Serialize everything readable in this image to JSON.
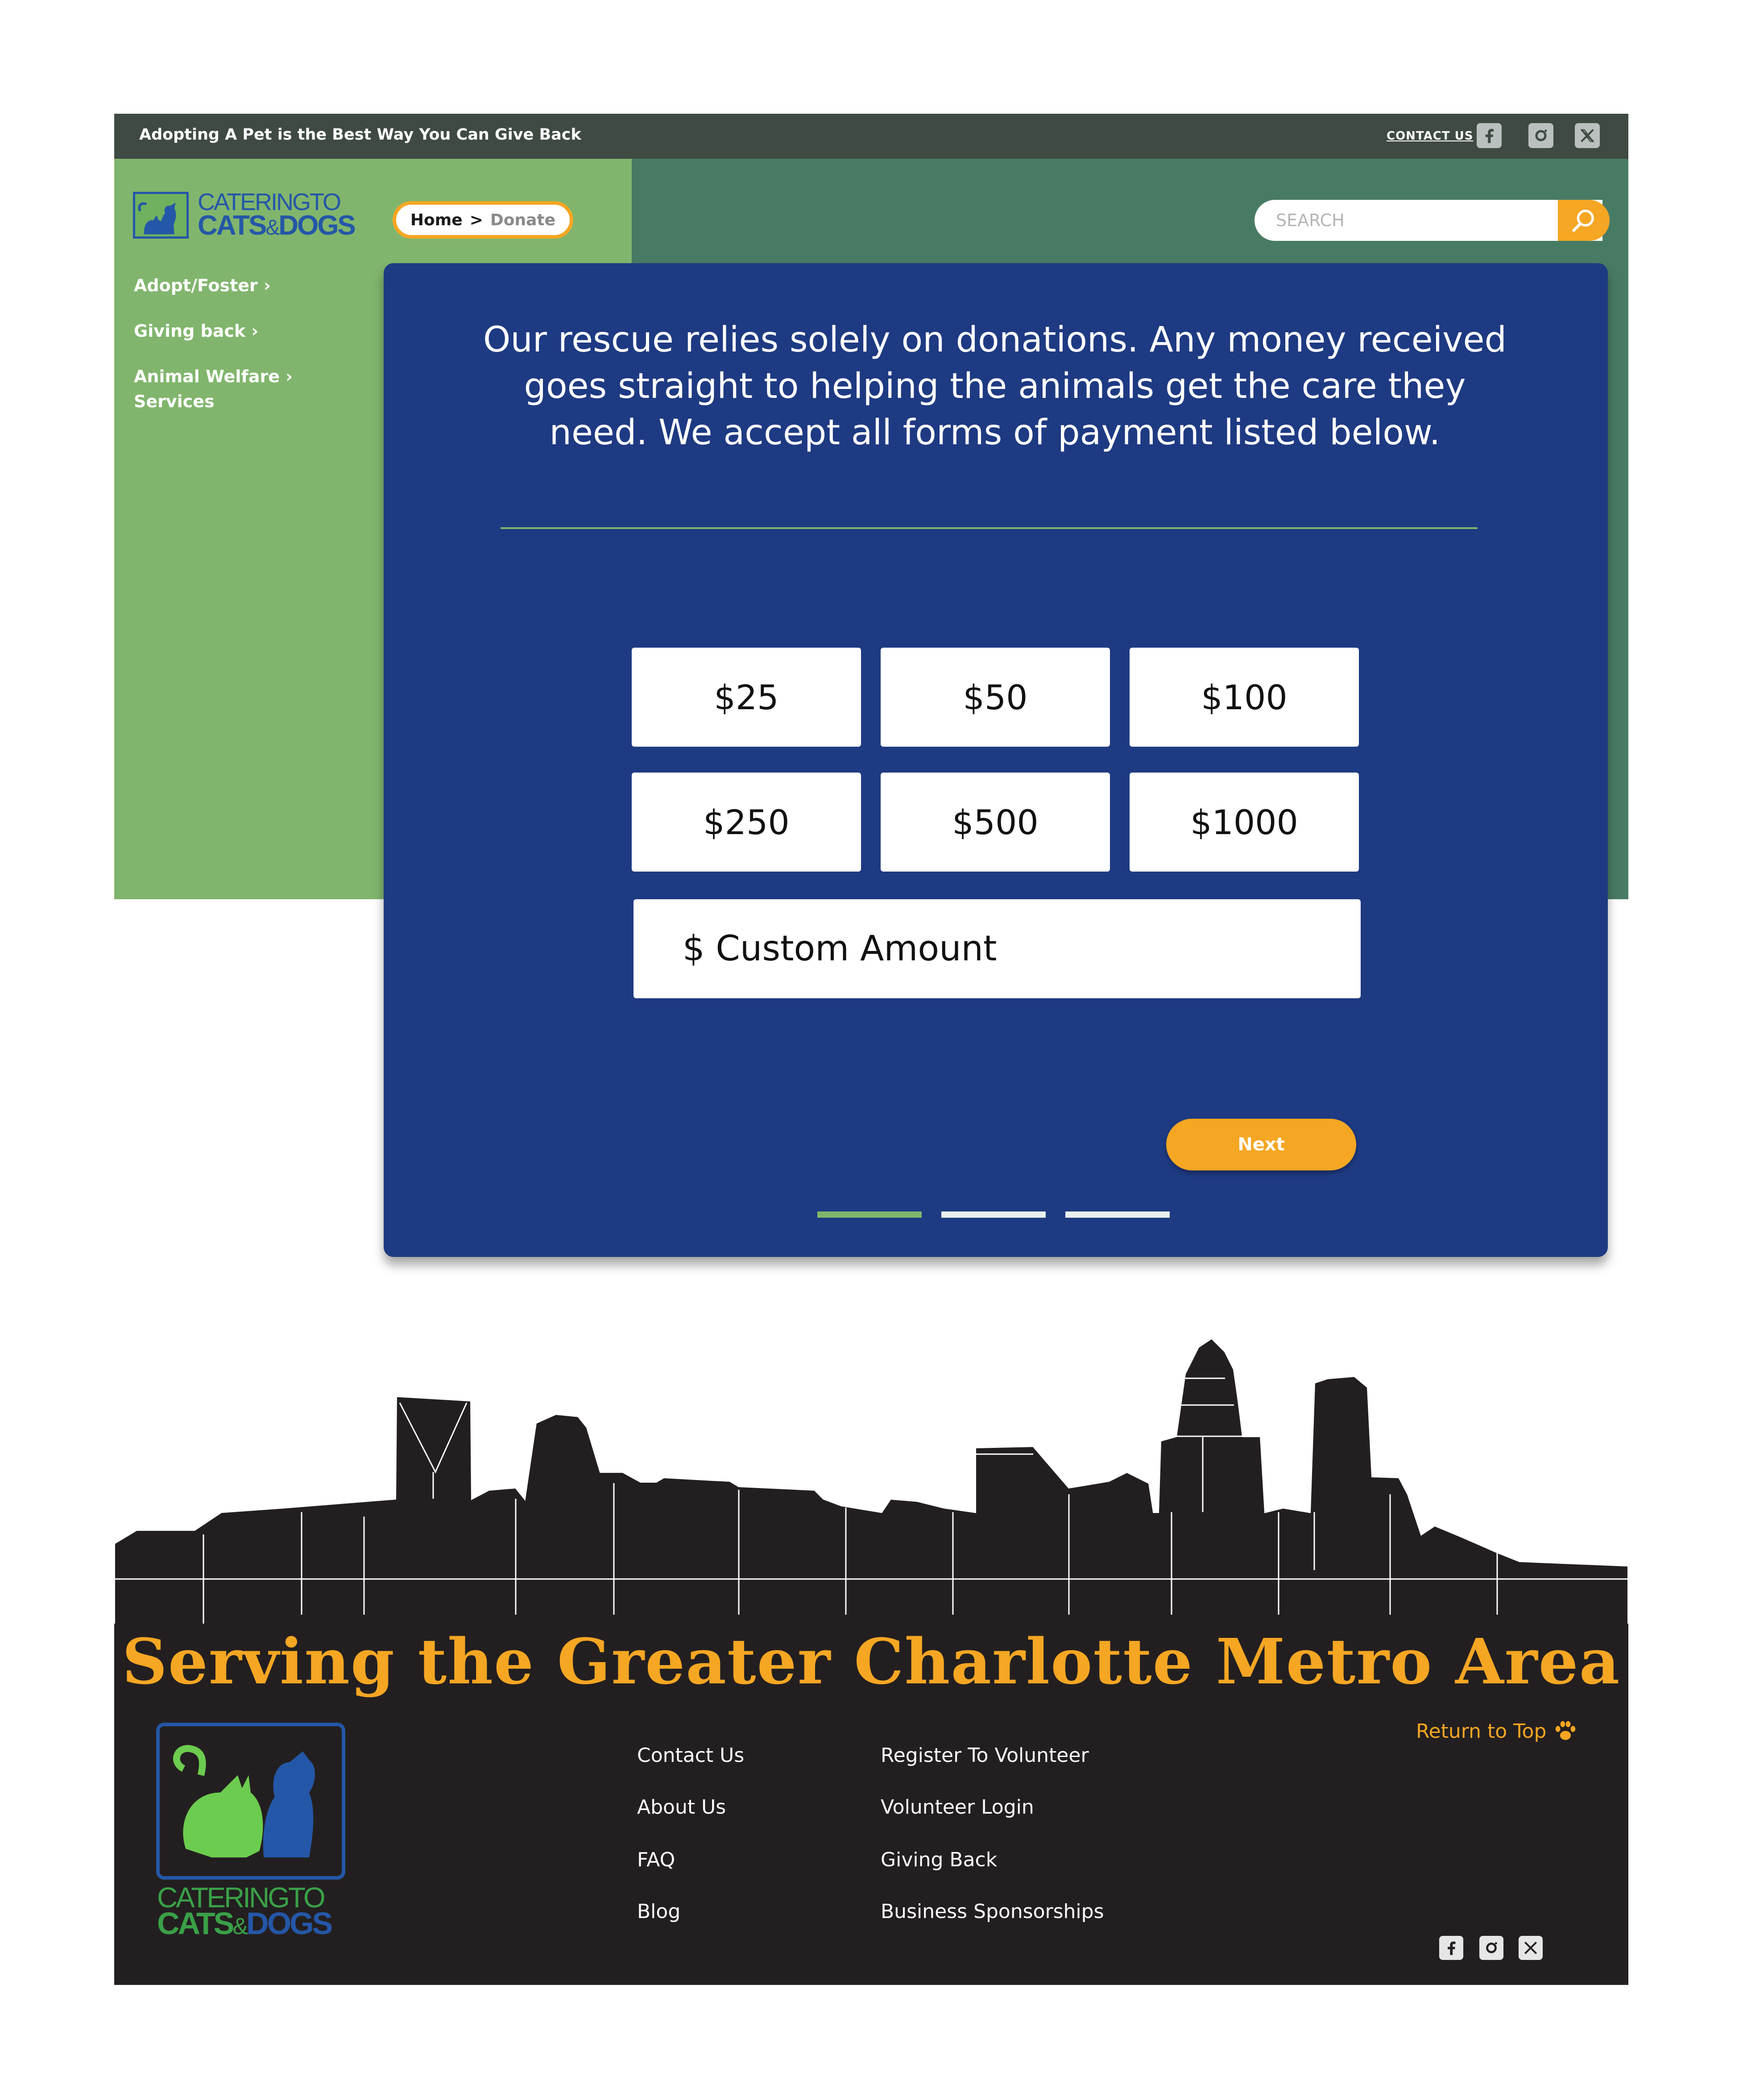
{
  "topbar": {
    "tagline": "Adopting A Pet is the Best Way You Can Give Back",
    "contact_label": "CONTACT US",
    "social": [
      "facebook-icon",
      "instagram-icon",
      "x-icon"
    ]
  },
  "logo": {
    "line1": "CATERINGTO",
    "line2a": "CATS",
    "amp": "&",
    "line2b": "DOGS"
  },
  "breadcrumb": {
    "home": "Home",
    "separator": ">",
    "current": "Donate"
  },
  "nav": {
    "items": [
      {
        "label": "Adopt/Foster"
      },
      {
        "label": "Giving back"
      },
      {
        "label": "Animal Welfare",
        "label2": "Services"
      }
    ]
  },
  "search": {
    "placeholder": "SEARCH"
  },
  "donate": {
    "intro": "Our rescue relies solely on donations. Any money received goes straight to helping the animals get the care they need. We accept all forms of payment listed below.",
    "amounts": [
      "$25",
      "$50",
      "$100",
      "$250",
      "$500",
      "$1000"
    ],
    "custom_label": "$ Custom Amount",
    "next_label": "Next",
    "steps": {
      "total": 3,
      "current": 1
    }
  },
  "footer": {
    "headline": "Serving the Greater Charlotte Metro Area",
    "return_top": "Return to Top",
    "links_col1": [
      "Contact Us",
      "About Us",
      "FAQ",
      "Blog"
    ],
    "links_col2": [
      "Register To Volunteer",
      "Volunteer Login",
      "Giving Back",
      "Business Sponsorships"
    ]
  },
  "colors": {
    "topbar": "#3f4a43",
    "left_green": "#81b56d",
    "dark_green": "#487b64",
    "card_blue": "#1e3a82",
    "accent_orange": "#f5a623",
    "footer_dark": "#231f20",
    "brand_blue": "#2457a7"
  }
}
